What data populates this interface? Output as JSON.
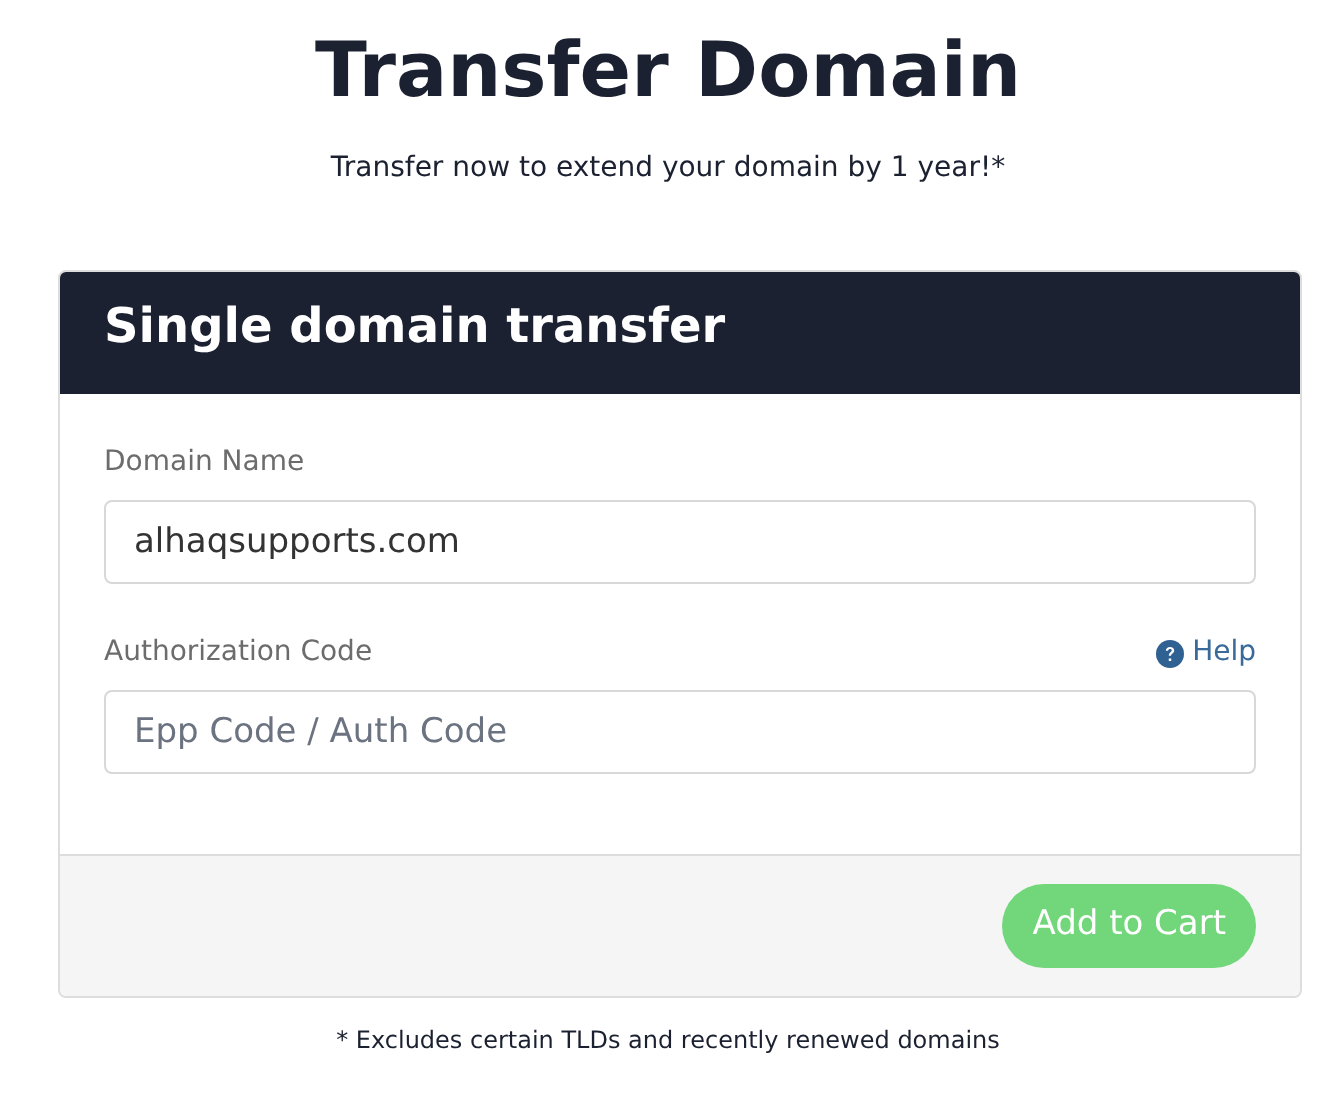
{
  "page": {
    "title": "Transfer Domain",
    "subtitle": "Transfer now to extend your domain by 1 year!*"
  },
  "card": {
    "title": "Single domain transfer",
    "fields": [
      {
        "label": "Domain Name",
        "value": "alhaqsupports.com"
      },
      {
        "label": "Authorization Code",
        "placeholder": "Epp Code / Auth Code",
        "help": "Help"
      }
    ],
    "button": "Add to Cart"
  },
  "footnote": "* Excludes certain TLDs and recently renewed domains"
}
